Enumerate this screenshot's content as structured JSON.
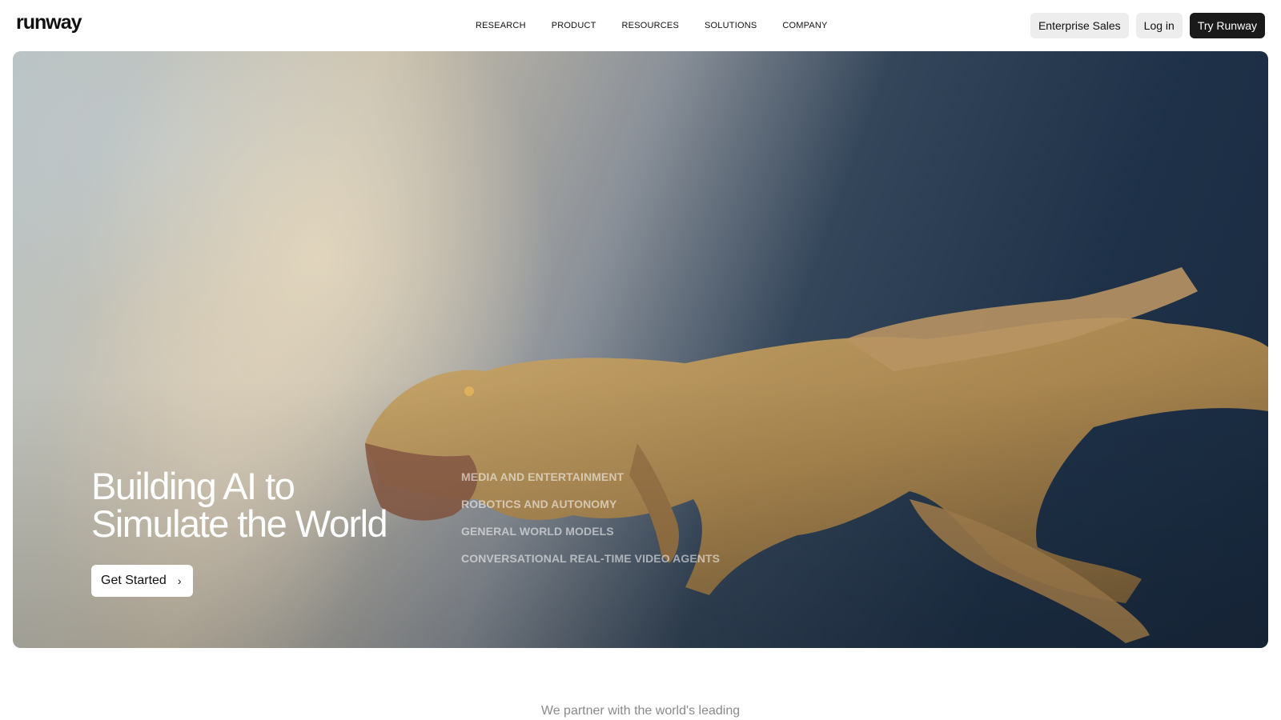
{
  "brand": {
    "logo_text": "runway"
  },
  "nav": [
    {
      "label": "RESEARCH"
    },
    {
      "label": "PRODUCT"
    },
    {
      "label": "RESOURCES"
    },
    {
      "label": "SOLUTIONS"
    },
    {
      "label": "COMPANY"
    }
  ],
  "actions": {
    "enterprise_label": "Enterprise Sales",
    "login_label": "Log in",
    "try_label": "Try Runway"
  },
  "hero": {
    "headline_line1": "Building AI to",
    "headline_line2": "Simulate the World",
    "cta_label": "Get Started",
    "sectors": [
      "MEDIA AND ENTERTAINMENT",
      "ROBOTICS AND AUTONOMY",
      "GENERAL WORLD MODELS",
      "CONVERSATIONAL REAL-TIME VIDEO AGENTS"
    ]
  },
  "partner_text": "We partner with the world's leading",
  "colors": {
    "dark_button": "#1a1a1a",
    "light_button": "#ededed",
    "text_primary": "#111111"
  }
}
